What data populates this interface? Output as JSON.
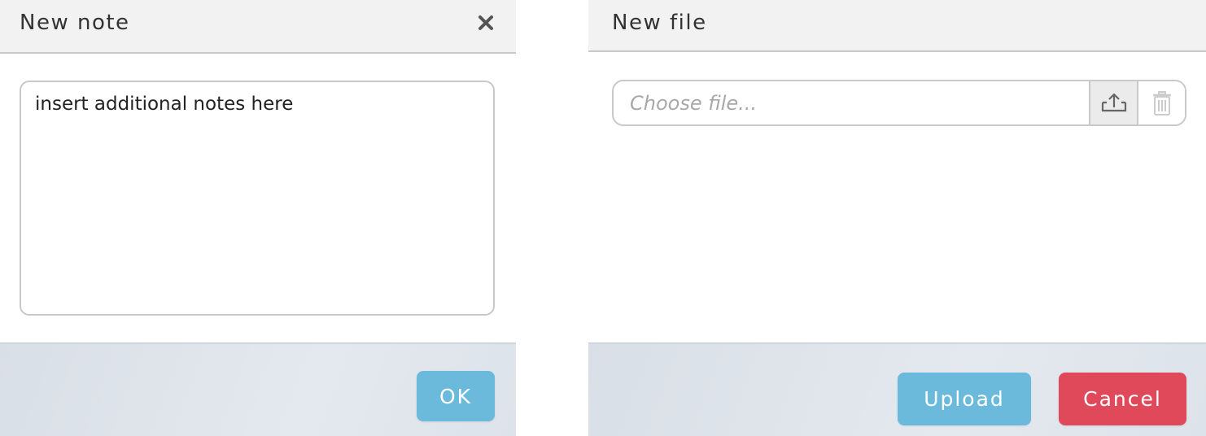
{
  "note_dialog": {
    "title": "New note",
    "textarea_value": "insert additional notes here",
    "ok_label": "OK"
  },
  "file_dialog": {
    "title": "New file",
    "file_placeholder": "Choose file...",
    "upload_icon": "upload-icon",
    "delete_icon": "trash-icon",
    "upload_label": "Upload",
    "cancel_label": "Cancel"
  },
  "colors": {
    "primary": "#6bbadc",
    "danger": "#e0495a",
    "header_bg": "#f2f2f2",
    "footer_bg": "#dde3ea"
  }
}
